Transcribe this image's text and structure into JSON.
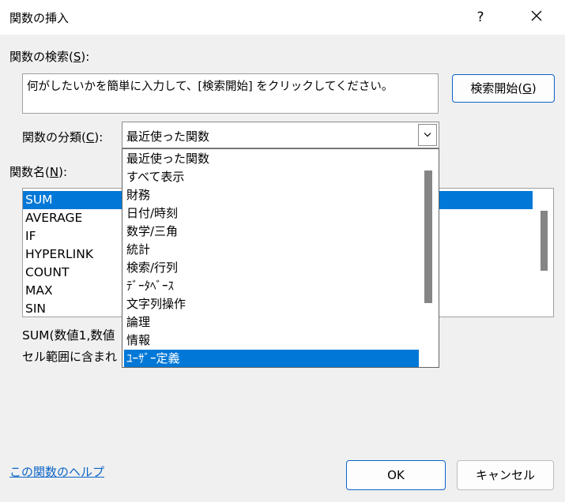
{
  "window": {
    "title": "関数の挿入",
    "help_glyph": "?",
    "close_icon": "close-icon"
  },
  "search": {
    "label": "関数の検索(",
    "label_key": "S",
    "label_end": "):",
    "value": "何がしたいかを簡単に入力して、[検索開始] をクリックしてください。",
    "button_label": "検索開始(",
    "button_key": "G",
    "button_end": ")"
  },
  "category": {
    "label": "関数の分類(",
    "label_key": "C",
    "label_end": "):",
    "selected": "最近使った関数",
    "options": [
      "最近使った関数",
      "すべて表示",
      "財務",
      "日付/時刻",
      "数学/三角",
      "統計",
      "検索/行列",
      "ﾃﾞｰﾀﾍﾞｰｽ",
      "文字列操作",
      "論理",
      "情報",
      "ﾕｰｻﾞｰ定義"
    ],
    "highlighted_index": 11
  },
  "functions": {
    "label": "関数名(",
    "label_key": "N",
    "label_end": "):",
    "items": [
      "SUM",
      "AVERAGE",
      "IF",
      "HYPERLINK",
      "COUNT",
      "MAX",
      "SIN"
    ],
    "selected_index": 0
  },
  "details": {
    "syntax": "SUM(数値1,数値",
    "description": "セル範囲に含まれ"
  },
  "footer": {
    "help_link": "この関数のヘルプ",
    "ok_label": "OK",
    "cancel_label": "キャンセル"
  },
  "colors": {
    "selection": "#0078d7",
    "accent": "#0a64c8"
  }
}
